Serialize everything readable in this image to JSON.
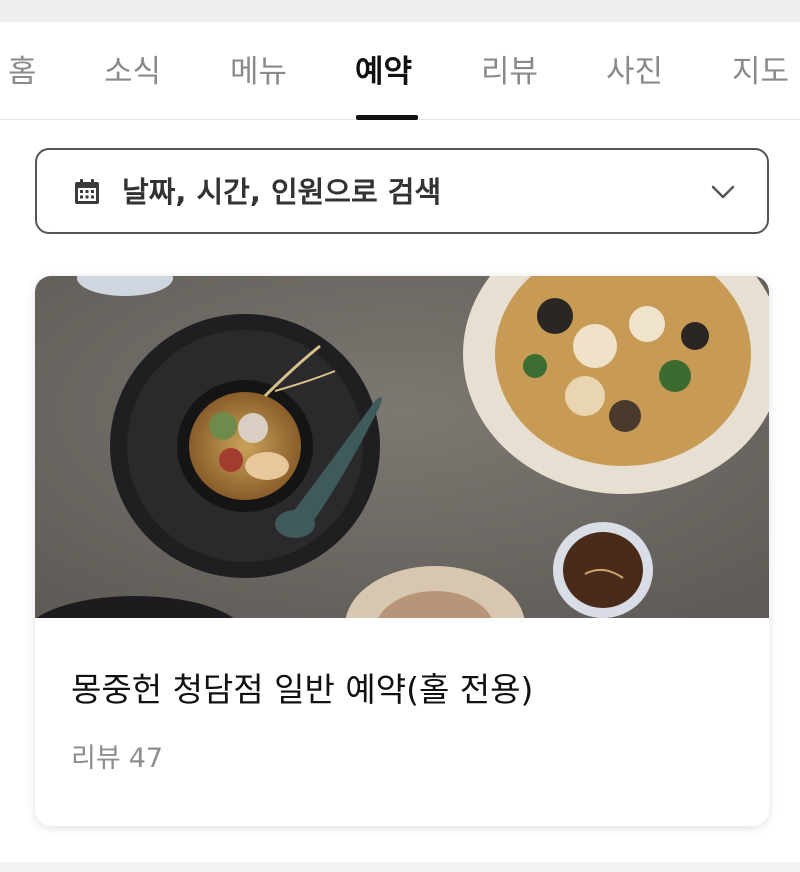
{
  "tabs": [
    {
      "label": "홈",
      "active": false
    },
    {
      "label": "소식",
      "active": false
    },
    {
      "label": "메뉴",
      "active": false
    },
    {
      "label": "예약",
      "active": true
    },
    {
      "label": "리뷰",
      "active": false
    },
    {
      "label": "사진",
      "active": false
    },
    {
      "label": "지도",
      "active": false
    }
  ],
  "search": {
    "label": "날짜, 시간, 인원으로 검색",
    "icon": "calendar-icon",
    "dropdown_icon": "chevron-down-icon"
  },
  "card": {
    "title": "몽중헌 청담점 일반 예약(홀 전용)",
    "review_label": "리뷰",
    "review_count": "47",
    "image": "food-photo"
  },
  "colors": {
    "active_tab": "#111111",
    "inactive_tab": "#8a8a8a",
    "border": "#555555"
  }
}
